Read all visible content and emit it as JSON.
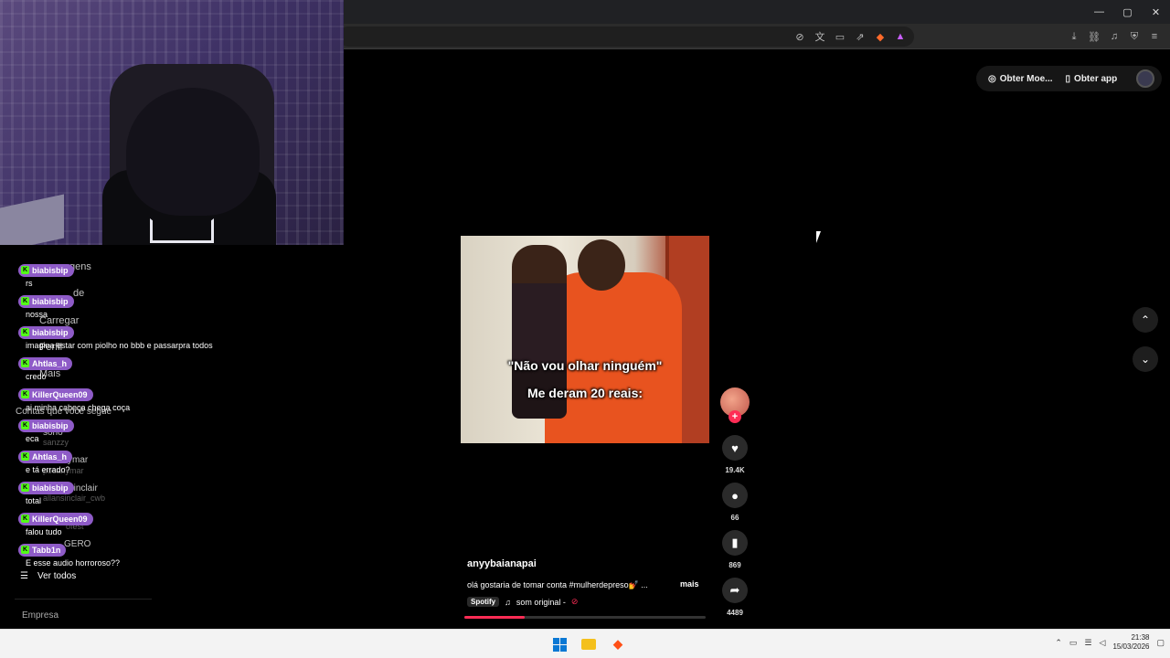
{
  "browser": {
    "window_controls": [
      "—",
      "▢",
      "✕"
    ],
    "url_icons": [
      "translate-off-icon",
      "translate-icon",
      "cast-icon",
      "share-icon"
    ],
    "toolbar_icons": [
      "download-icon",
      "link-icon",
      "music-icon",
      "vpn-icon",
      "menu-icon"
    ]
  },
  "page_actions": {
    "coins_label": "Obter Moe...",
    "app_label": "Obter app"
  },
  "sidebar_ghost": [
    {
      "text": "gens"
    },
    {
      "text": "de"
    },
    {
      "text": "Carregar"
    },
    {
      "text": "Perfil"
    },
    {
      "text": "Mais"
    },
    {
      "text": "Contas que você segue"
    },
    {
      "text": "sono"
    },
    {
      "text": "sanzzy"
    },
    {
      "text": "ymar"
    },
    {
      "text": "pocariymar"
    },
    {
      "text": "Sinclair"
    },
    {
      "text": "allansinclair_cwb"
    },
    {
      "text": "ofest"
    },
    {
      "text": "GERO"
    }
  ],
  "chat": {
    "messages": [
      {
        "user": "biabisbip",
        "text": "rs"
      },
      {
        "user": "biabisbip",
        "text": "nossa"
      },
      {
        "user": "biabisbip",
        "text": "imagina estar com piolho no bbb e passarpra todos"
      },
      {
        "user": "Ahtlas_h",
        "text": "credo"
      },
      {
        "user": "KillerQueen09",
        "text": "ai minha cabeça chega coça"
      },
      {
        "user": "biabisbip",
        "text": "eca"
      },
      {
        "user": "Ahtlas_h",
        "text": "e tá errado?"
      },
      {
        "user": "biabisbip",
        "text": "total"
      },
      {
        "user": "KillerQueen09",
        "text": "falou tudo"
      },
      {
        "user": "Tabb1n",
        "text": "E esse audio horroroso??"
      }
    ],
    "ver_todos": "Ver todos",
    "empresa": "Empresa"
  },
  "video": {
    "caption_line1": "\"Não vou olhar ninguém\"",
    "caption_line2": "Me deram 20 reais:",
    "author": "anyybaianapai",
    "description": "olá gostaria de tomar conta #mulherdepreso💅 ...",
    "more_label": "mais",
    "spotify_label": "Spotify",
    "sound_label": "som original -",
    "progress": 0.25
  },
  "actions": {
    "likes": "19.4K",
    "comments": "66",
    "saves": "869",
    "shares": "4489"
  },
  "taskbar": {
    "time": "21:38",
    "date": "15/03/2026"
  }
}
